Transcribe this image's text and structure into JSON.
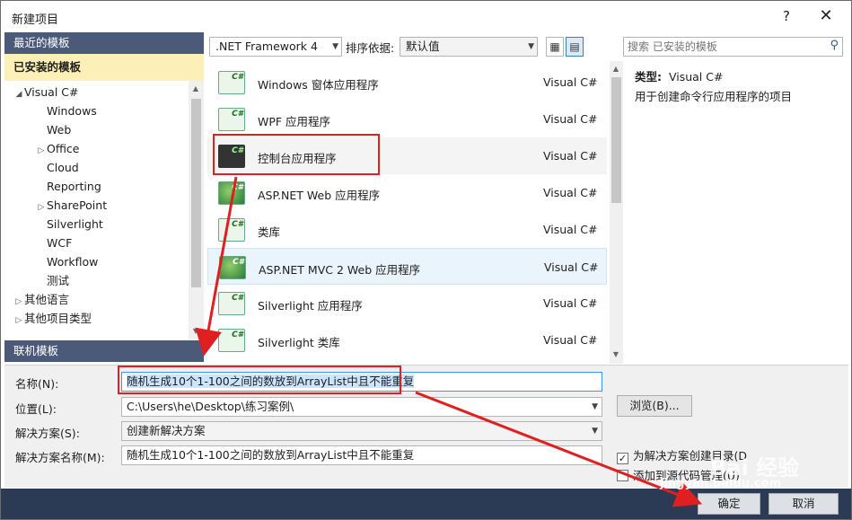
{
  "window": {
    "title": "新建项目",
    "help_label": "?",
    "close_label": "✕"
  },
  "left_panel": {
    "recent_label": "最近的模板",
    "installed_label": "已安装的模板",
    "online_label": "联机模板",
    "tree": [
      {
        "label": "Visual C#",
        "level": 0,
        "arrow": "◢"
      },
      {
        "label": "Windows",
        "level": 1,
        "arrow": ""
      },
      {
        "label": "Web",
        "level": 1,
        "arrow": ""
      },
      {
        "label": "Office",
        "level": 1,
        "arrow": "▷"
      },
      {
        "label": "Cloud",
        "level": 1,
        "arrow": ""
      },
      {
        "label": "Reporting",
        "level": 1,
        "arrow": ""
      },
      {
        "label": "SharePoint",
        "level": 1,
        "arrow": "▷"
      },
      {
        "label": "Silverlight",
        "level": 1,
        "arrow": ""
      },
      {
        "label": "WCF",
        "level": 1,
        "arrow": ""
      },
      {
        "label": "Workflow",
        "level": 1,
        "arrow": ""
      },
      {
        "label": "测试",
        "level": 1,
        "arrow": ""
      },
      {
        "label": "其他语言",
        "level": 0,
        "arrow": "▷"
      },
      {
        "label": "其他项目类型",
        "level": 0,
        "arrow": "▷"
      }
    ]
  },
  "toolbar": {
    "framework": ".NET Framework 4",
    "sort_label": "排序依据:",
    "sort_value": "默认值"
  },
  "templates": [
    {
      "name": "Windows 窗体应用程序",
      "lang": "Visual C#",
      "icon": "winforms-icon"
    },
    {
      "name": "WPF 应用程序",
      "lang": "Visual C#",
      "icon": "wpf-icon"
    },
    {
      "name": "控制台应用程序",
      "lang": "Visual C#",
      "icon": "console-icon"
    },
    {
      "name": "ASP.NET Web 应用程序",
      "lang": "Visual C#",
      "icon": "aspnet-icon"
    },
    {
      "name": "类库",
      "lang": "Visual C#",
      "icon": "class-library-icon"
    },
    {
      "name": "ASP.NET MVC 2 Web 应用程序",
      "lang": "Visual C#",
      "icon": "aspnet-mvc-icon"
    },
    {
      "name": "Silverlight 应用程序",
      "lang": "Visual C#",
      "icon": "silverlight-icon"
    },
    {
      "name": "Silverlight 类库",
      "lang": "Visual C#",
      "icon": "silverlight-library-icon"
    }
  ],
  "search": {
    "placeholder": "搜索 已安装的模板"
  },
  "details": {
    "type_label": "类型:",
    "type_value": "Visual C#",
    "description": "用于创建命令行应用程序的项目"
  },
  "form": {
    "name_label": "名称(N):",
    "name_value": "随机生成10个1-100之间的数放到ArrayList中且不能重复",
    "location_label": "位置(L):",
    "location_value": "C:\\Users\\he\\Desktop\\练习案例\\",
    "solution_label": "解决方案(S):",
    "solution_value": "创建新解决方案",
    "solution_name_label": "解决方案名称(M):",
    "solution_name_value": "随机生成10个1-100之间的数放到ArrayList中且不能重复",
    "browse_label": "浏览(B)...",
    "create_dir_label": "为解决方案创建目录(D",
    "create_dir_checked": true,
    "add_source_label": "添加到源代码管理(U)",
    "add_source_checked": false,
    "ok_label": "确定",
    "cancel_label": "取消"
  },
  "watermark": {
    "brand": "Bai 经验",
    "url": "jingyan.baidu.com"
  },
  "colors": {
    "section_header": "#4a5a78",
    "selected_section": "#fcf0b8",
    "highlight_red": "#e02020",
    "footer": "#2b3a55"
  }
}
